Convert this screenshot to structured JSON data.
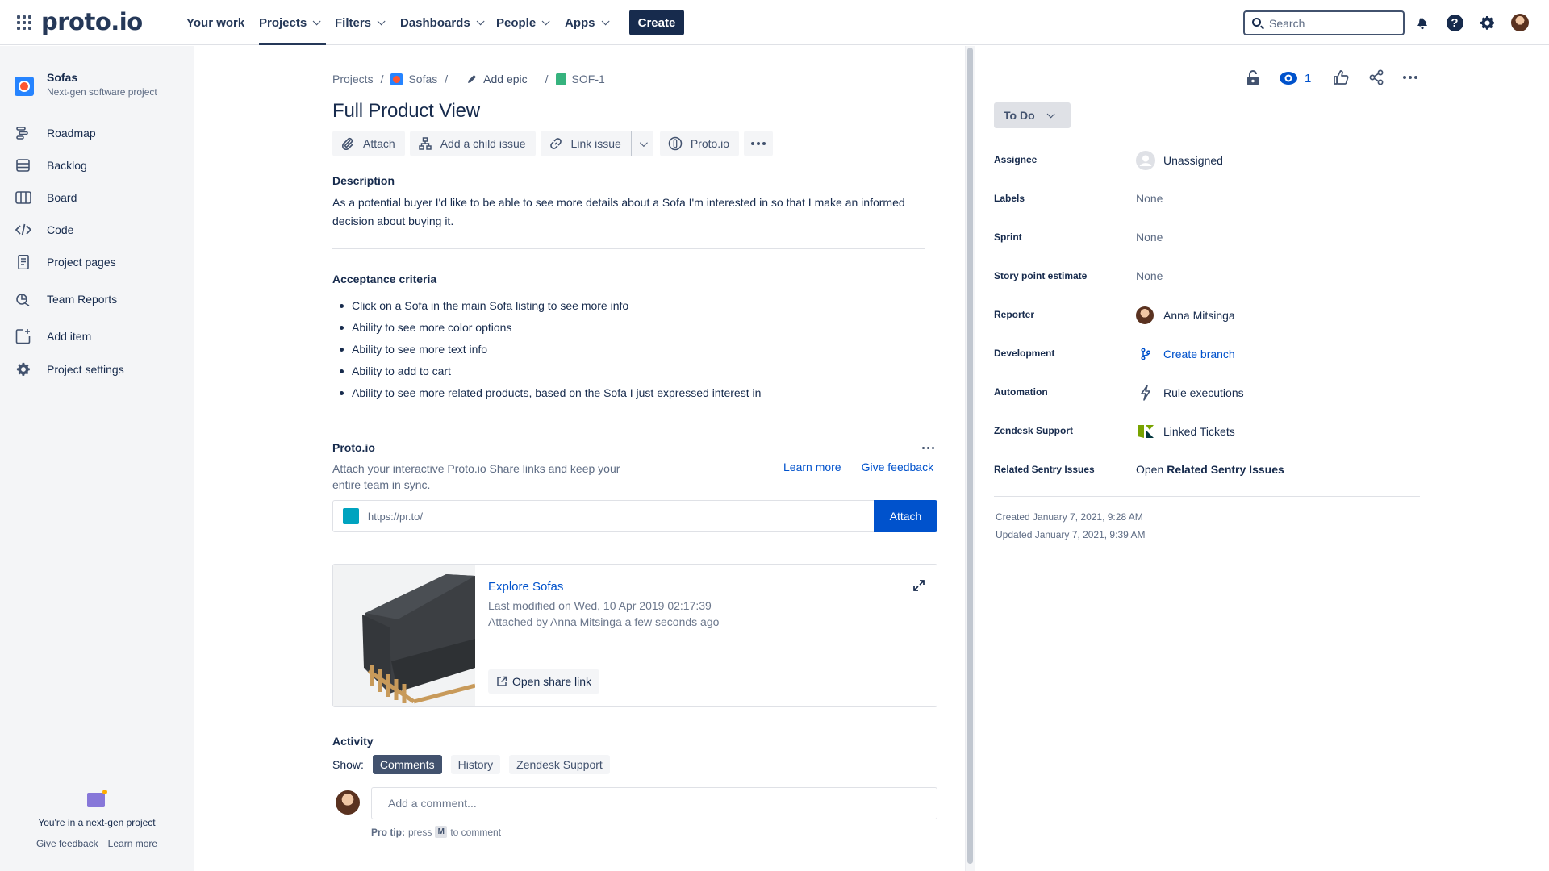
{
  "topnav": {
    "logo": "proto.io",
    "items": [
      {
        "label": "Your work",
        "dropdown": false
      },
      {
        "label": "Projects",
        "dropdown": true,
        "active": true
      },
      {
        "label": "Filters",
        "dropdown": true
      },
      {
        "label": "Dashboards",
        "dropdown": true
      },
      {
        "label": "People",
        "dropdown": true
      },
      {
        "label": "Apps",
        "dropdown": true
      }
    ],
    "create_label": "Create",
    "search_placeholder": "Search",
    "icons": [
      "apps-grid-icon",
      "notifications-icon",
      "help-icon",
      "settings-icon",
      "user-avatar"
    ]
  },
  "sidebar": {
    "project_name": "Sofas",
    "project_type": "Next-gen software project",
    "items": [
      {
        "label": "Roadmap",
        "icon": "roadmap-icon"
      },
      {
        "label": "Backlog",
        "icon": "backlog-icon"
      },
      {
        "label": "Board",
        "icon": "board-icon"
      },
      {
        "label": "Code",
        "icon": "code-icon"
      },
      {
        "label": "Project pages",
        "icon": "pages-icon"
      },
      {
        "label": "Team Reports",
        "icon": "reports-icon"
      },
      {
        "label": "Add item",
        "icon": "add-item-icon"
      },
      {
        "label": "Project settings",
        "icon": "settings-icon"
      }
    ],
    "footer_text": "You're in a next-gen project",
    "footer_links": [
      "Give feedback",
      "Learn more"
    ]
  },
  "issue": {
    "breadcrumb": [
      "Projects",
      "Sofas",
      "Add epic",
      "SOF-1"
    ],
    "title": "Full Product View",
    "toolbar": {
      "attach": "Attach",
      "child": "Add a child issue",
      "link": "Link issue",
      "proto": "Proto.io"
    },
    "description_heading": "Description",
    "description": "As a potential buyer I'd like to be able to see more details about a Sofa I'm interested in so that I make an informed decision about buying it.",
    "acceptance_heading": "Acceptance criteria",
    "acceptance_items": [
      "Click on a Sofa in the main Sofa listing to see more info",
      "Ability to see more color options",
      "Ability to see more text info",
      "Ability to add to cart",
      "Ability to see more related products, based on the Sofa I just expressed interest in"
    ]
  },
  "proto": {
    "heading": "Proto.io",
    "description": "Attach your interactive Proto.io Share links and keep your entire team in sync.",
    "learn_more": "Learn more",
    "give_feedback": "Give feedback",
    "url_value": "https://pr.to/",
    "attach_label": "Attach",
    "card": {
      "title": "Explore Sofas",
      "modified": "Last modified on Wed, 10 Apr 2019 02:17:39",
      "attached_by": "Attached by Anna Mitsinga a few seconds ago",
      "open_link": "Open share link"
    }
  },
  "activity": {
    "heading": "Activity",
    "show_label": "Show:",
    "filters": [
      "Comments",
      "History",
      "Zendesk Support"
    ],
    "active_filter": "Comments",
    "comment_placeholder": "Add a comment...",
    "pro_tip_label": "Pro tip:",
    "pro_tip_pre": "press",
    "pro_tip_key": "M",
    "pro_tip_post": "to comment"
  },
  "details": {
    "watchers_count": "1",
    "status": "To Do",
    "fields": [
      {
        "label": "Assignee",
        "value": "Unassigned",
        "icon": "unassigned-avatar-icon"
      },
      {
        "label": "Labels",
        "value": "None"
      },
      {
        "label": "Sprint",
        "value": "None"
      },
      {
        "label": "Story point estimate",
        "value": "None"
      },
      {
        "label": "Reporter",
        "value": "Anna Mitsinga",
        "icon": "reporter-avatar"
      },
      {
        "label": "Development",
        "value": "Create branch",
        "icon": "branch-icon"
      },
      {
        "label": "Automation",
        "value": "Rule executions",
        "icon": "lightning-icon"
      },
      {
        "label": "Zendesk Support",
        "value": "Linked Tickets",
        "icon": "zendesk-icon"
      },
      {
        "label": "Related Sentry Issues",
        "value_prefix": "Open",
        "value": "Related Sentry Issues"
      }
    ],
    "created": "Created January 7, 2021, 9:28 AM",
    "updated": "Updated January 7, 2021, 9:39 AM"
  },
  "colors": {
    "primary": "#0052cc",
    "dark": "#172b4d",
    "muted": "#5e6c84",
    "status_bg": "#dfe1e6"
  }
}
